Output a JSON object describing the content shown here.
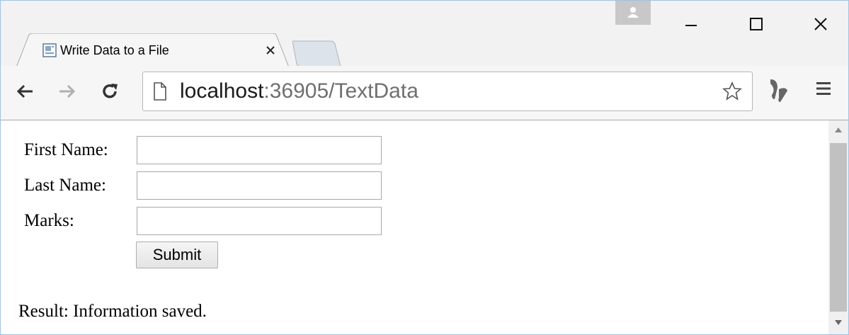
{
  "window": {
    "controls": {
      "profile": "profile-icon",
      "minimize": "minimize-icon",
      "maximize": "maximize-icon",
      "close": "close-icon"
    }
  },
  "tab": {
    "title": "Write Data to a File",
    "favicon": "page-favicon-icon",
    "close": "close-icon"
  },
  "toolbar": {
    "back": "arrow-left-icon",
    "forward": "arrow-right-icon",
    "reload": "reload-icon",
    "address": {
      "host": "localhost",
      "path": ":36905/TextData"
    },
    "bookmark": "star-icon",
    "extension": "extension-icon",
    "menu": "hamburger-menu-icon"
  },
  "form": {
    "first_name_label": "First Name:",
    "first_name_value": "",
    "last_name_label": "Last Name:",
    "last_name_value": "",
    "marks_label": "Marks:",
    "marks_value": "",
    "submit_label": "Submit"
  },
  "result_text": "Result: Information saved.",
  "colors": {
    "window_border": "#9fc3e2",
    "chrome_bg": "#f2f2f2",
    "page_bg": "#ffffff",
    "path_text": "#6f6f6f"
  }
}
